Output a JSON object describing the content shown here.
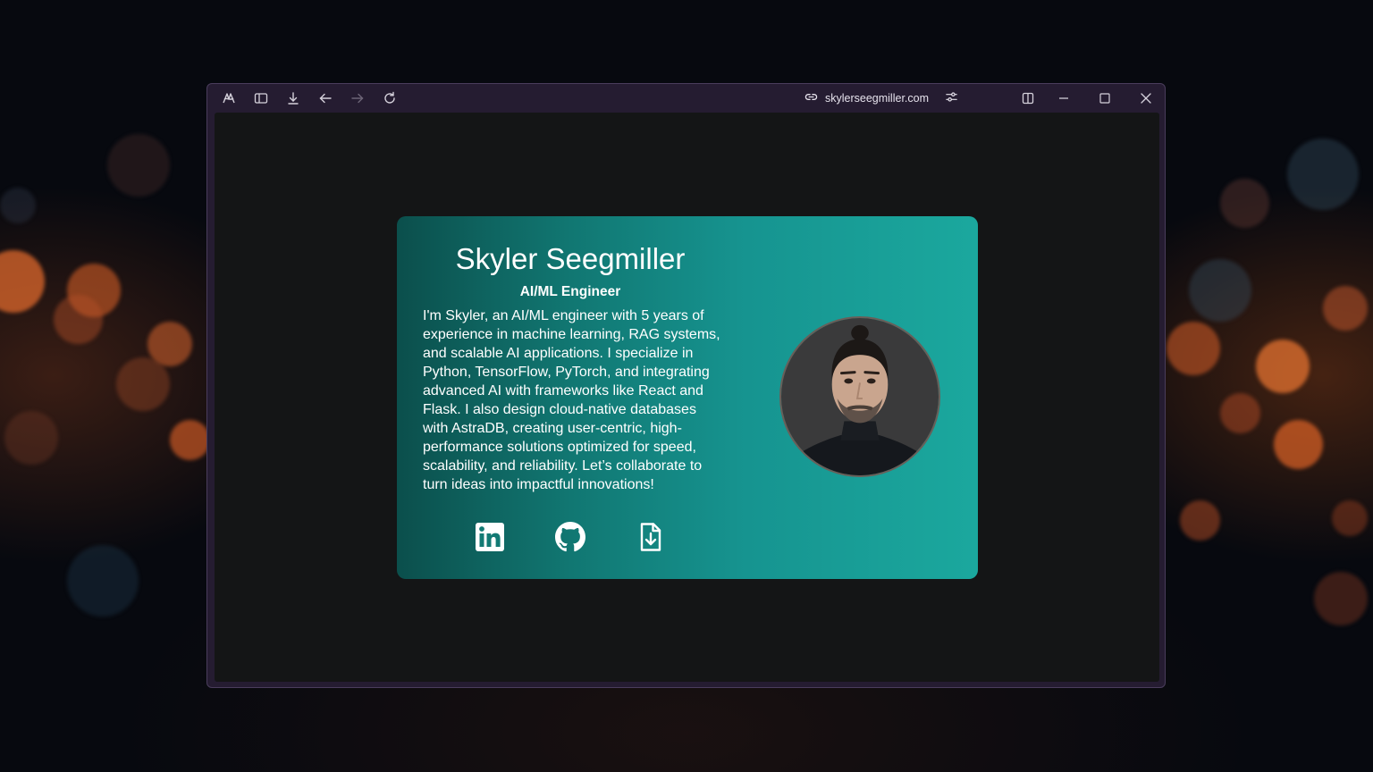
{
  "browser": {
    "url": "skylerseegmiller.com",
    "toolbar_icons": [
      "arc-logo-icon",
      "sidebar-toggle-icon",
      "download-icon",
      "back-arrow-icon",
      "forward-arrow-icon",
      "reload-icon",
      "link-icon",
      "site-settings-icon",
      "split-view-icon",
      "minimize-icon",
      "maximize-icon",
      "close-icon"
    ]
  },
  "profile": {
    "name": "Skyler Seegmiller",
    "role": "AI/ML Engineer",
    "bio_lines": [
      "I'm Skyler, an AI/ML engineer with 5 years of",
      "experience in machine learning, RAG systems,",
      "and scalable AI applications. I specialize in",
      "Python, TensorFlow, PyTorch, and integrating",
      "advanced AI with frameworks like React and",
      "Flask. I also design cloud-native databases",
      "with AstraDB, creating user-centric, high-",
      "performance solutions optimized for speed,",
      "scalability, and reliability. Let’s collaborate to",
      "turn ideas into impactful innovations!"
    ],
    "social_icons": [
      "linkedin-icon",
      "github-icon",
      "resume-download-icon"
    ]
  },
  "colors": {
    "card_gradient_start": "#0b4f4c",
    "card_gradient_end": "#1ba89e",
    "page_background": "#141516",
    "browser_chrome": "#251c31"
  }
}
